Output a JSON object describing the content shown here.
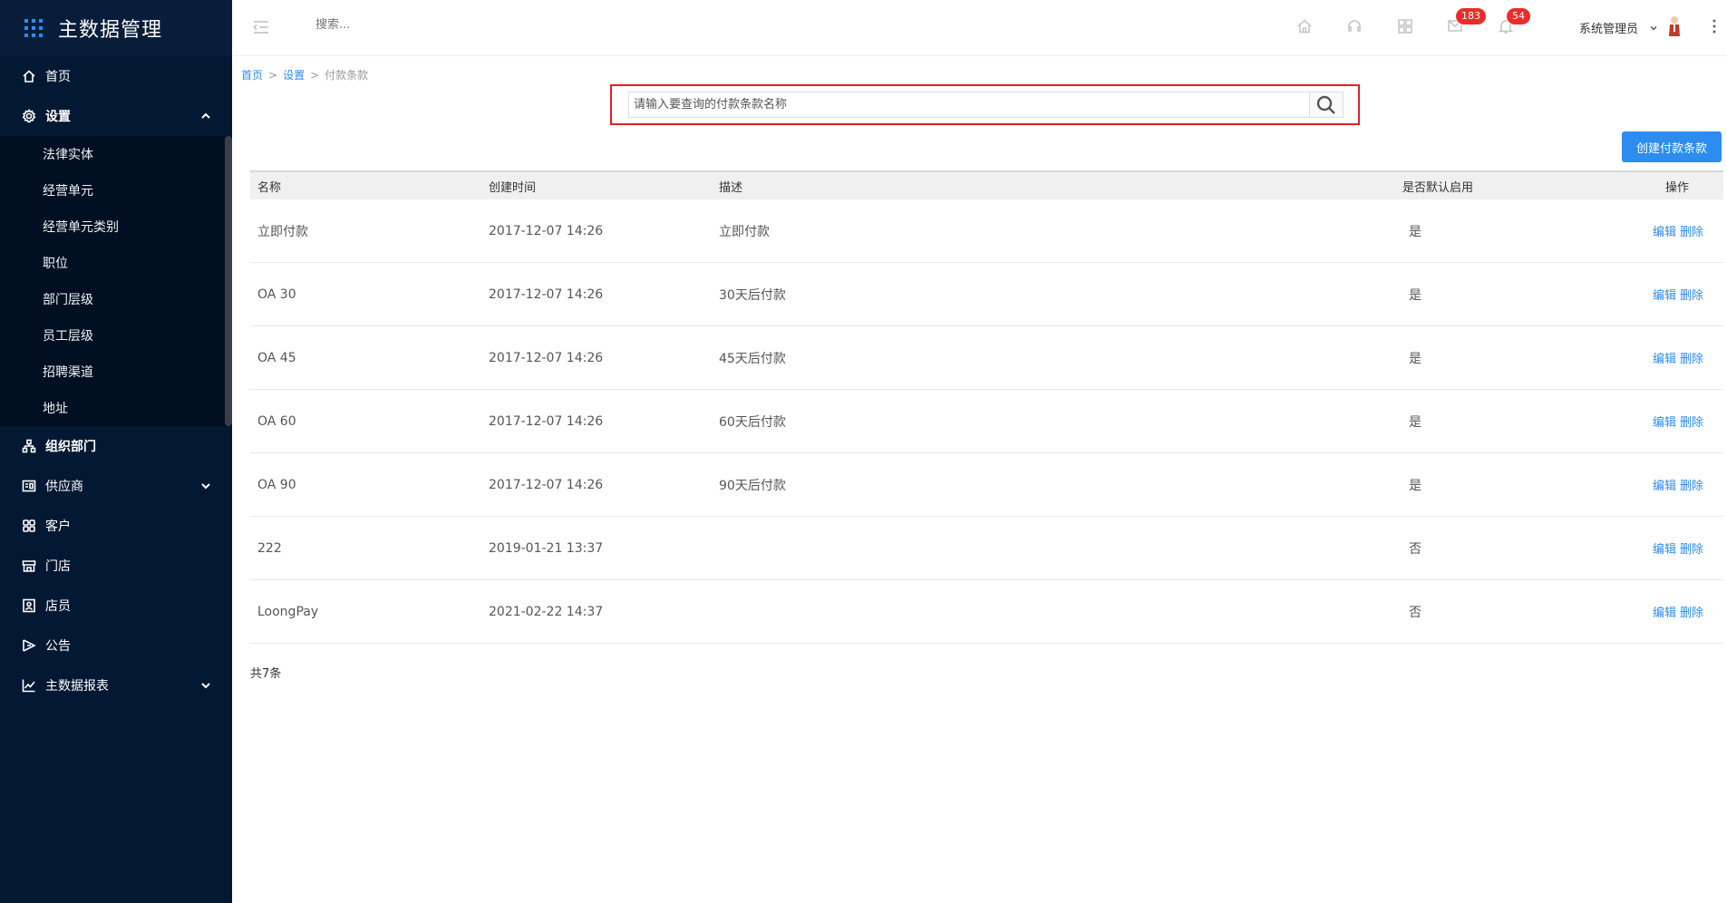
{
  "brand": {
    "title": "主数据管理"
  },
  "sidebar": {
    "items": [
      {
        "label": "首页",
        "icon": "home-icon"
      },
      {
        "label": "设置",
        "icon": "gear-icon",
        "expanded": true,
        "children": [
          "法律实体",
          "经营单元",
          "经营单元类别",
          "职位",
          "部门层级",
          "员工层级",
          "招聘渠道",
          "地址"
        ]
      },
      {
        "label": "组织部门",
        "icon": "org-icon"
      },
      {
        "label": "供应商",
        "icon": "supplier-icon"
      },
      {
        "label": "客户",
        "icon": "customer-icon"
      },
      {
        "label": "门店",
        "icon": "store-icon"
      },
      {
        "label": "店员",
        "icon": "clerk-icon"
      },
      {
        "label": "公告",
        "icon": "notice-icon"
      },
      {
        "label": "主数据报表",
        "icon": "chart-icon"
      }
    ]
  },
  "header": {
    "search_placeholder": "搜索...",
    "badge_messages": "183",
    "badge_notifications": "54",
    "user_name": "系统管理员"
  },
  "breadcrumb": {
    "home": "首页",
    "settings": "设置",
    "current": "付款条款",
    "sep": ">"
  },
  "search": {
    "placeholder": "请输入要查询的付款条款名称"
  },
  "create_button": "创建付款条款",
  "table": {
    "headers": [
      "名称",
      "创建时间",
      "描述",
      "是否默认启用",
      "操作"
    ],
    "rows": [
      {
        "name": "立即付款",
        "created": "2017-12-07 14:26",
        "desc": "立即付款",
        "default": "是"
      },
      {
        "name": "OA 30",
        "created": "2017-12-07 14:26",
        "desc": "30天后付款",
        "default": "是"
      },
      {
        "name": "OA 45",
        "created": "2017-12-07 14:26",
        "desc": "45天后付款",
        "default": "是"
      },
      {
        "name": "OA 60",
        "created": "2017-12-07 14:26",
        "desc": "60天后付款",
        "default": "是"
      },
      {
        "name": "OA 90",
        "created": "2017-12-07 14:26",
        "desc": "90天后付款",
        "default": "是"
      },
      {
        "name": "222",
        "created": "2019-01-21 13:37",
        "desc": "",
        "default": "否"
      },
      {
        "name": "LoongPay",
        "created": "2021-02-22 14:37",
        "desc": "",
        "default": "否"
      }
    ],
    "edit_label": "编辑",
    "delete_label": "删除"
  },
  "total": "共7条",
  "colors": {
    "sidebar_bg": "#031833",
    "accent": "#2d8cf0",
    "badge": "#ed2b2b",
    "highlight_border": "#e32020"
  }
}
